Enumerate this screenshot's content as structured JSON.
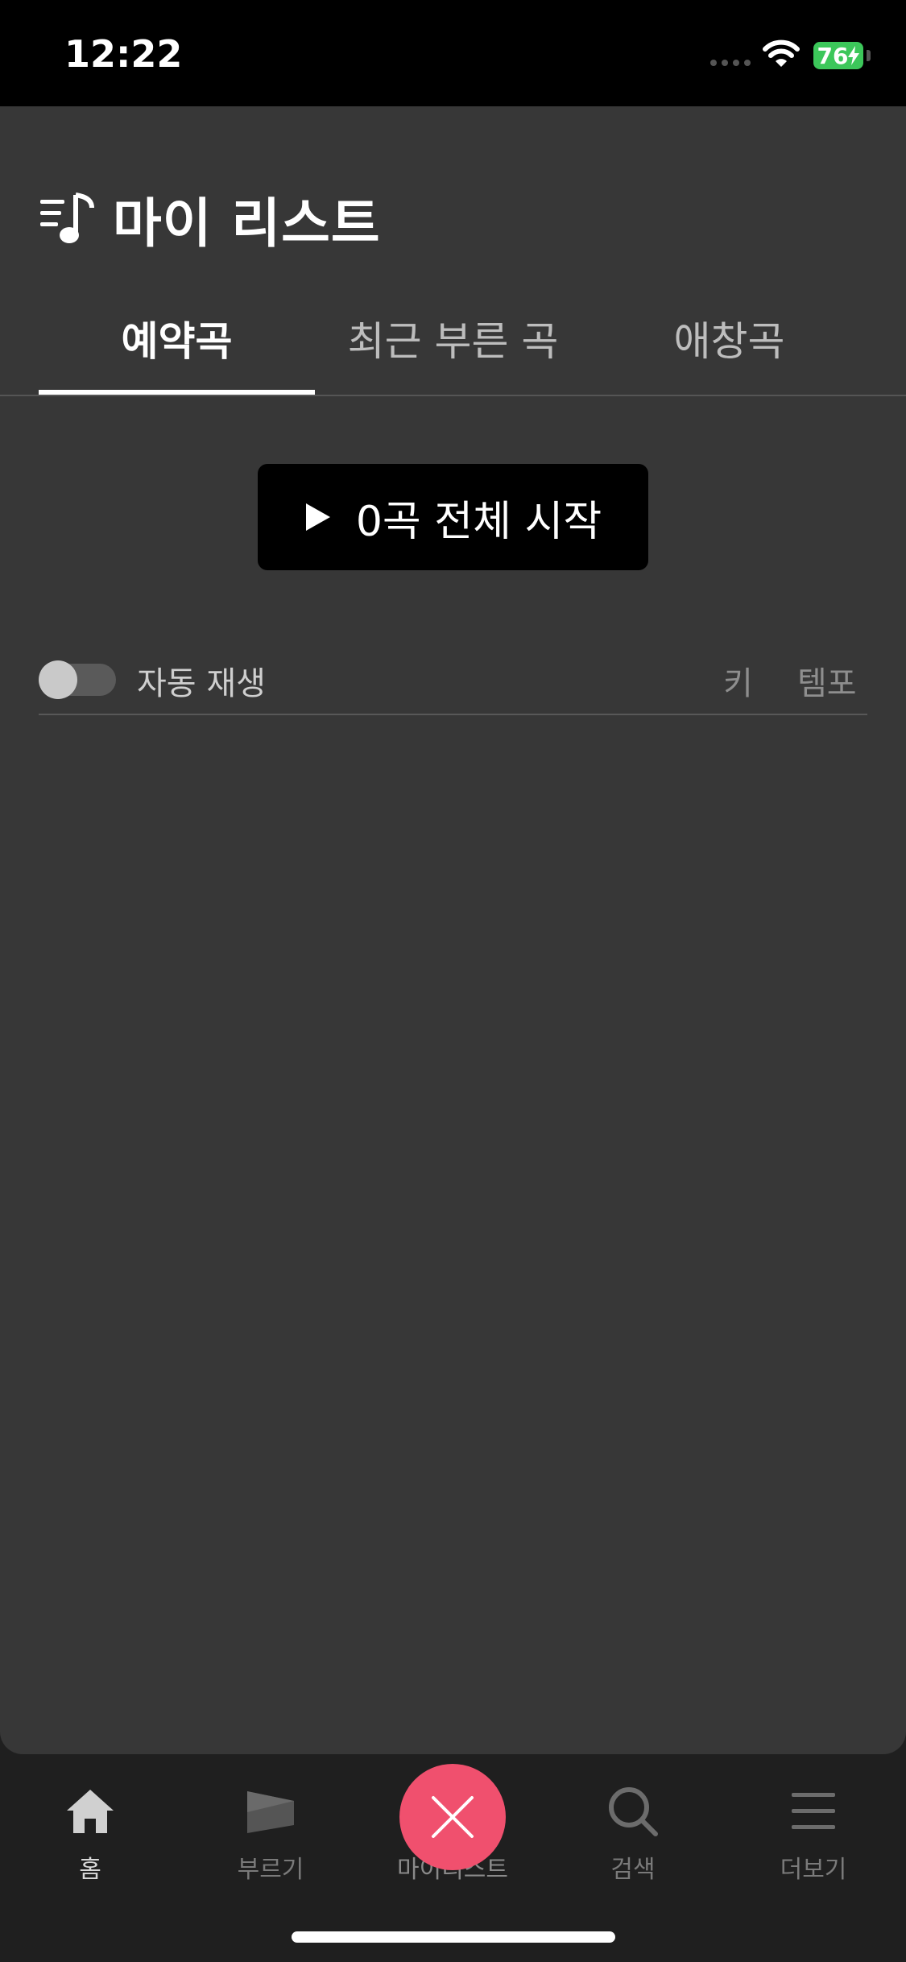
{
  "status_bar": {
    "time": "12:22",
    "battery": "76"
  },
  "header": {
    "title": "마이 리스트",
    "icon": "playlist-music-icon"
  },
  "tabs": [
    {
      "label": "예약곡",
      "active": true
    },
    {
      "label": "최근 부른 곡",
      "active": false
    },
    {
      "label": "애창곡",
      "active": false
    }
  ],
  "start_all": {
    "label": "0곡 전체 시작",
    "icon": "play-icon"
  },
  "list_header": {
    "autoplay_label": "자동 재생",
    "autoplay_on": false,
    "col_key": "키",
    "col_tempo": "템포"
  },
  "tab_bar": {
    "items": [
      {
        "label": "홈",
        "icon": "home-icon",
        "active": true
      },
      {
        "label": "부르기",
        "icon": "sing-icon",
        "active": false
      },
      {
        "label": "마이리스트",
        "icon": "close-icon",
        "active": false
      },
      {
        "label": "검색",
        "icon": "search-icon",
        "active": false
      },
      {
        "label": "더보기",
        "icon": "menu-icon",
        "active": false
      }
    ]
  },
  "colors": {
    "accent": "#f0506e",
    "sheet": "#373737",
    "background": "#1f1f1f",
    "battery": "#3cc75a"
  }
}
